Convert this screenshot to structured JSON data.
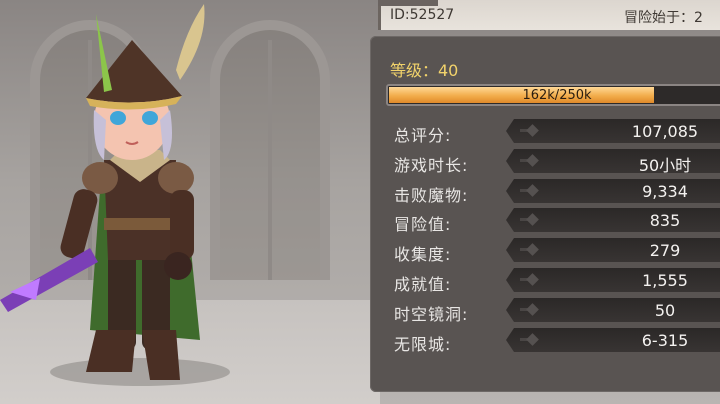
{
  "header": {
    "id_label": "ID:52527",
    "adventure_start_label": "冒险始于：2"
  },
  "level": {
    "label": "等级：40",
    "xp_text": "162k/250k",
    "xp_progress": 0.792
  },
  "stats": [
    {
      "label": "总评分:",
      "value": "107,085"
    },
    {
      "label": "游戏时长:",
      "value": "50小时"
    },
    {
      "label": "击败魔物:",
      "value": "9,334"
    },
    {
      "label": "冒险值:",
      "value": "835"
    },
    {
      "label": "收集度:",
      "value": "279"
    },
    {
      "label": "成就值:",
      "value": "1,555"
    },
    {
      "label": "时空镜洞:",
      "value": "50"
    },
    {
      "label": "无限城:",
      "value": "6-315"
    }
  ],
  "colors": {
    "panel_bg": "#595452",
    "level_text": "#f2d36b",
    "xp_fill": "#f2ad4b",
    "stat_text": "#e8e6e4"
  },
  "icons": {
    "character": "hero-character-portrait",
    "weapon": "purple-crystal-sword"
  }
}
